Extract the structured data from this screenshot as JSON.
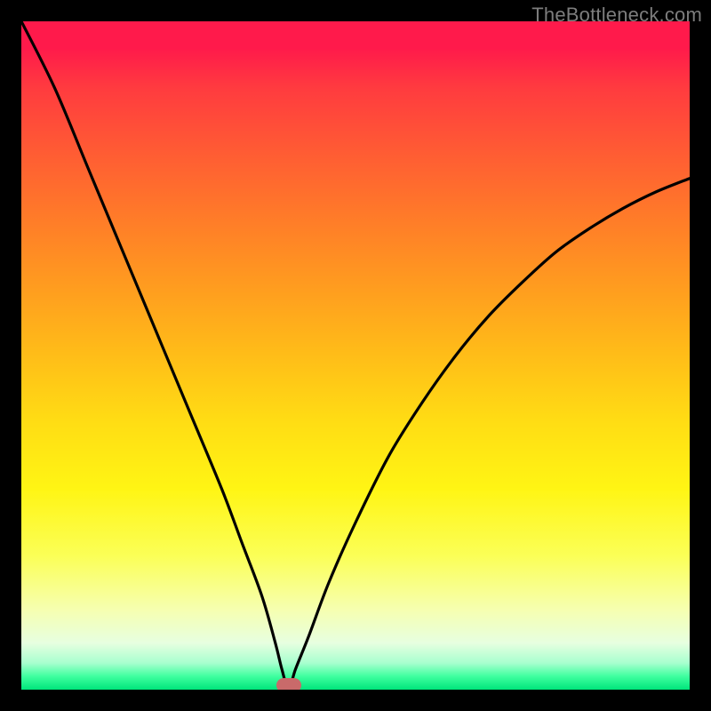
{
  "watermark": "TheBottleneck.com",
  "colors": {
    "frame": "#000000",
    "curve": "#000000",
    "marker": "#c96a6a",
    "gradient_top": "#ff1a4b",
    "gradient_bottom": "#00e57b"
  },
  "chart_data": {
    "type": "line",
    "title": "",
    "xlabel": "",
    "ylabel": "",
    "xlim": [
      0,
      100
    ],
    "ylim": [
      0,
      100
    ],
    "marker": {
      "x": 40.0,
      "y": 0.0
    },
    "series": [
      {
        "name": "bottleneck-curve",
        "x": [
          0.0,
          5.0,
          10.0,
          15.0,
          20.0,
          25.0,
          30.0,
          33.0,
          36.0,
          38.0,
          39.0,
          40.0,
          41.0,
          43.0,
          46.0,
          50.0,
          55.0,
          60.0,
          65.0,
          70.0,
          75.0,
          80.0,
          85.0,
          90.0,
          95.0,
          100.0
        ],
        "y": [
          100.0,
          90.0,
          78.0,
          66.0,
          54.0,
          42.0,
          30.0,
          22.0,
          14.0,
          7.0,
          3.0,
          0.0,
          3.0,
          8.0,
          16.0,
          25.0,
          35.0,
          43.0,
          50.0,
          56.0,
          61.0,
          65.5,
          69.0,
          72.0,
          74.5,
          76.5
        ]
      }
    ]
  }
}
